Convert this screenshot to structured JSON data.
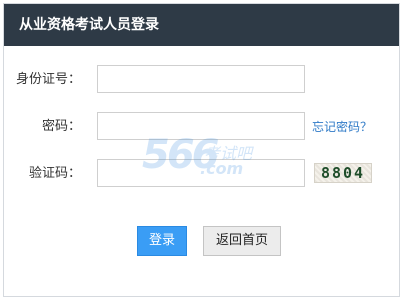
{
  "header": {
    "title": "从业资格考试人员登录"
  },
  "form": {
    "id_label": "身份证号：",
    "id_value": "",
    "password_label": "密码：",
    "password_value": "",
    "forgot_link": "忘记密码？",
    "captcha_label": "验证码：",
    "captcha_value": "",
    "captcha_code": "8804"
  },
  "actions": {
    "login_label": "登录",
    "back_home_label": "返回首页"
  },
  "watermark": {
    "number": "566",
    "cn": "考试吧",
    "domain": ".com"
  },
  "colors": {
    "header_bg": "#2e3a46",
    "login_button": "#3a9df5",
    "link": "#2f7ac7"
  }
}
